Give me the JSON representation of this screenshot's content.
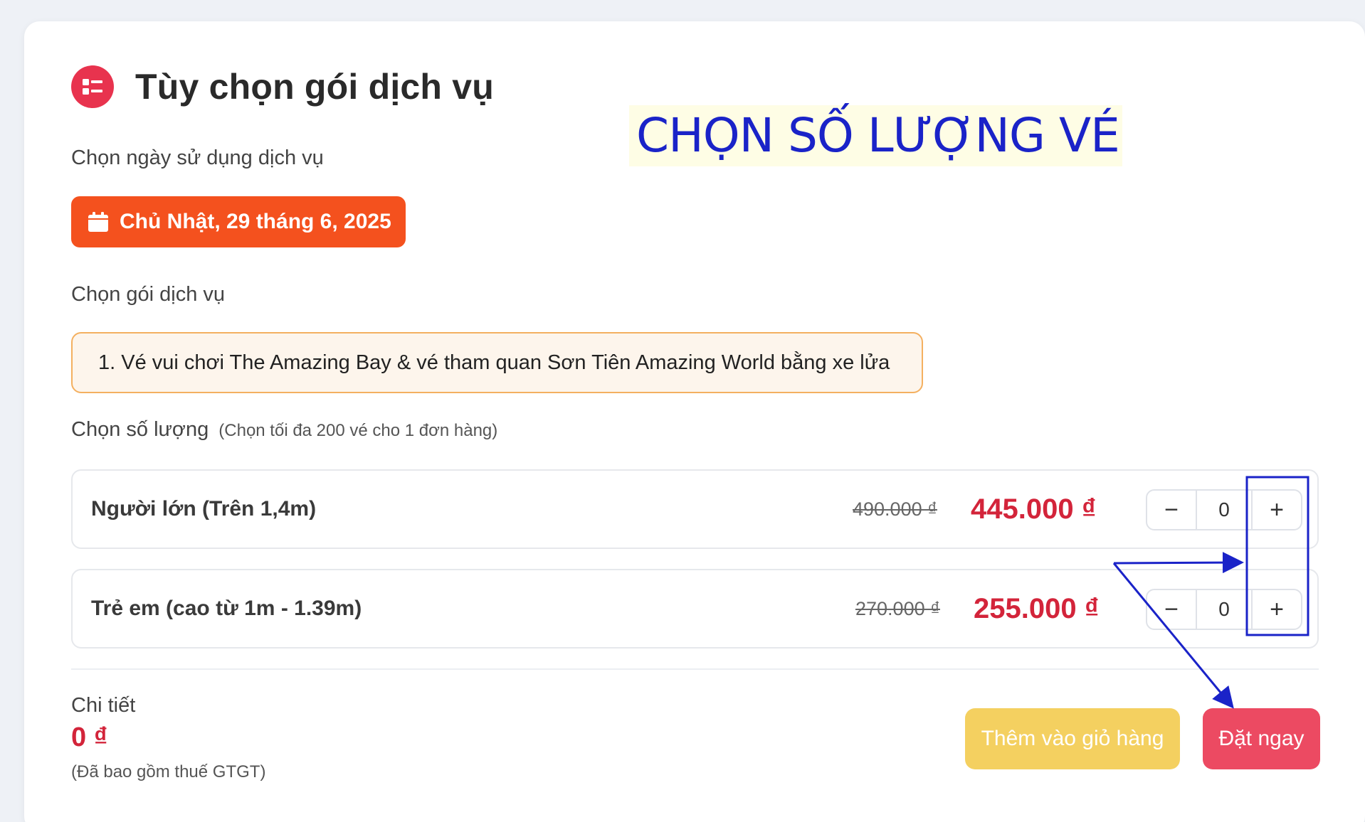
{
  "header": {
    "title": "Tùy chọn gói dịch vụ",
    "icon": "list-icon"
  },
  "annotation": {
    "text": "CHỌN SỐ LƯỢNG VÉ",
    "color": "#1a23c8"
  },
  "date_section": {
    "label": "Chọn ngày sử dụng dịch vụ",
    "selected_date": "Chủ Nhật, 29 tháng 6, 2025",
    "icon": "calendar-icon"
  },
  "package_section": {
    "label": "Chọn gói dịch vụ",
    "selected_package": "1. Vé vui chơi The Amazing Bay & vé tham quan Sơn Tiên Amazing World bằng xe lửa"
  },
  "quantity_section": {
    "label": "Chọn số lượng",
    "note": "(Chọn tối đa 200 vé cho 1 đơn hàng)",
    "rows": [
      {
        "name": "Người lớn (Trên 1,4m)",
        "old_price": "490.000 ₫",
        "new_price": "445.000 ₫",
        "minus": "−",
        "quantity": "0",
        "plus": "+"
      },
      {
        "name": "Trẻ em (cao từ 1m - 1.39m)",
        "old_price": "270.000 ₫",
        "new_price": "255.000 ₫",
        "minus": "−",
        "quantity": "0",
        "plus": "+"
      }
    ]
  },
  "summary": {
    "label": "Chi tiết",
    "total": "0 ₫",
    "vat_note": "(Đã bao gồm thuế GTGT)"
  },
  "actions": {
    "add_to_cart": "Thêm vào giỏ hàng",
    "book_now": "Đặt ngay"
  },
  "colors": {
    "accent_red": "#d3243a",
    "date_button": "#f4511e",
    "cart_button": "#f4d060",
    "book_button": "#ec4a62",
    "annotation_blue": "#1a23c8"
  }
}
